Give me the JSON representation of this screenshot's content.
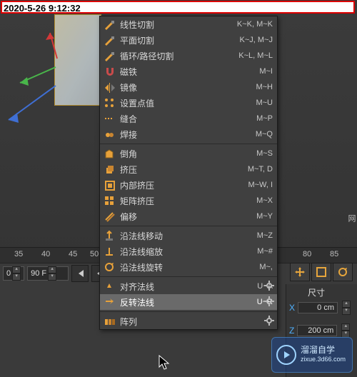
{
  "timestamp": "2020-5-26 9:12:32",
  "ruler": {
    "ticks": [
      "35",
      "40",
      "45",
      "50",
      "80",
      "85"
    ]
  },
  "controls": {
    "frame_a": "0",
    "frame_b": "90 F"
  },
  "menu": {
    "group1": [
      {
        "icon": "knife",
        "label": "线性切割",
        "shortcut": "K~K, M~K"
      },
      {
        "icon": "knife",
        "label": "平面切割",
        "shortcut": "K~J, M~J"
      },
      {
        "icon": "knife",
        "label": "循环/路径切割",
        "shortcut": "K~L, M~L"
      },
      {
        "icon": "magnet",
        "label": "磁铁",
        "shortcut": "M~I"
      },
      {
        "icon": "mirror",
        "label": "镜像",
        "shortcut": "M~H"
      },
      {
        "icon": "points",
        "label": "设置点值",
        "shortcut": "M~U"
      },
      {
        "icon": "sew",
        "label": "缝合",
        "shortcut": "M~P"
      },
      {
        "icon": "weld",
        "label": "焊接",
        "shortcut": "M~Q"
      }
    ],
    "group2": [
      {
        "icon": "bevel",
        "label": "倒角",
        "shortcut": "M~S"
      },
      {
        "icon": "extrude",
        "label": "挤压",
        "shortcut": "M~T, D"
      },
      {
        "icon": "inner",
        "label": "内部挤压",
        "shortcut": "M~W, I"
      },
      {
        "icon": "matrix",
        "label": "矩阵挤压",
        "shortcut": "M~X"
      },
      {
        "icon": "offset",
        "label": "偏移",
        "shortcut": "M~Y"
      }
    ],
    "group3": [
      {
        "icon": "nmove",
        "label": "沿法线移动",
        "shortcut": "M~Z"
      },
      {
        "icon": "nscale",
        "label": "沿法线缩放",
        "shortcut": "M~#"
      },
      {
        "icon": "nrotate",
        "label": "沿法线旋转",
        "shortcut": "M~,"
      }
    ],
    "group4": [
      {
        "icon": "align",
        "label": "对齐法线",
        "shortcut": "U~A",
        "gear": true
      },
      {
        "icon": "reverse",
        "label": "反转法线",
        "shortcut": "U~R",
        "gear": true,
        "hover": true
      }
    ],
    "group5": [
      {
        "icon": "array",
        "label": "阵列",
        "shortcut": "",
        "gear": true
      }
    ]
  },
  "panel": {
    "title": "尺寸",
    "x": "0 cm",
    "z": "200 cm"
  },
  "far_right": "网",
  "watermark": {
    "line1": "溜溜自学",
    "line2": "zixue.3d66.com"
  }
}
